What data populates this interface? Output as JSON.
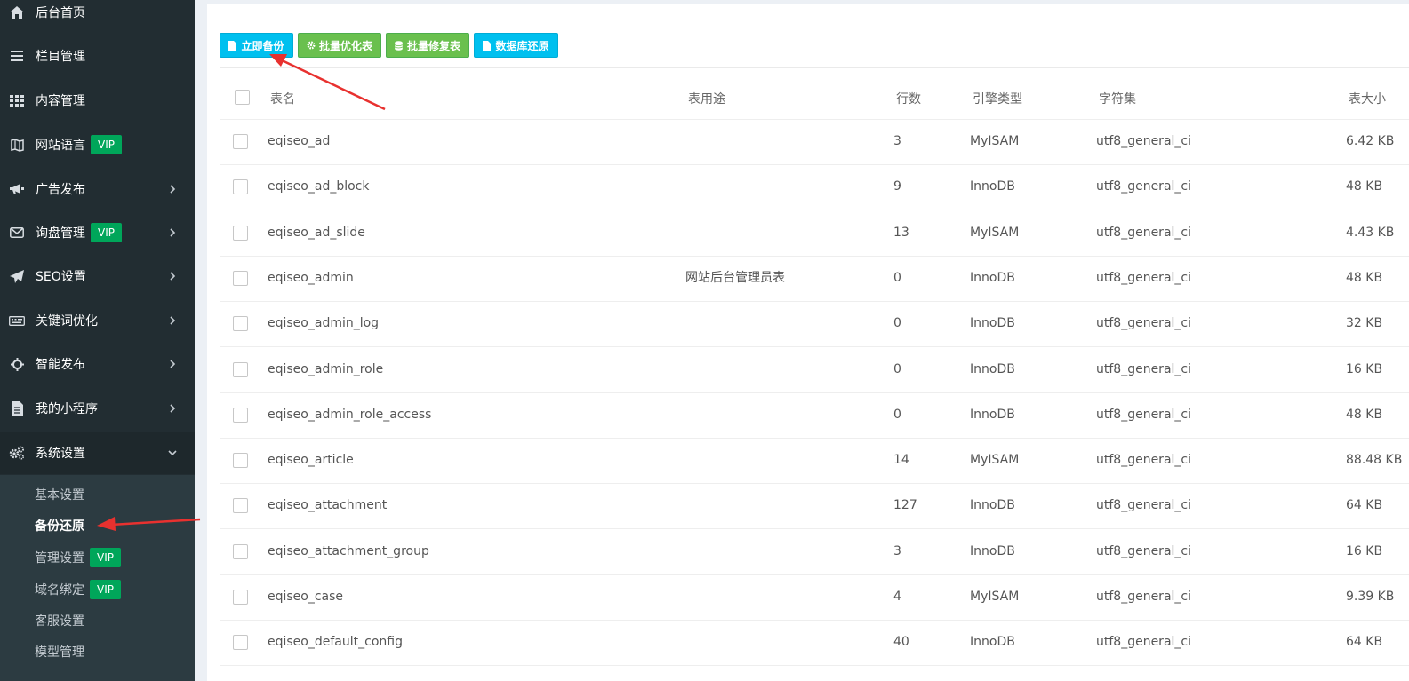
{
  "sidebar": {
    "menu": [
      {
        "label": "后台首页",
        "icon": "home-icon",
        "vip": false,
        "chevron": "none"
      },
      {
        "label": "栏目管理",
        "icon": "bars-icon",
        "vip": false,
        "chevron": "none"
      },
      {
        "label": "内容管理",
        "icon": "grid-icon",
        "vip": false,
        "chevron": "none"
      },
      {
        "label": "网站语言",
        "icon": "map-icon",
        "vip": true,
        "chevron": "none"
      },
      {
        "label": "广告发布",
        "icon": "bullhorn-icon",
        "vip": false,
        "chevron": "right"
      },
      {
        "label": "询盘管理",
        "icon": "envelope-icon",
        "vip": true,
        "chevron": "right"
      },
      {
        "label": "SEO设置",
        "icon": "paper-plane-icon",
        "vip": false,
        "chevron": "right"
      },
      {
        "label": "关键词优化",
        "icon": "keyboard-icon",
        "vip": false,
        "chevron": "right"
      },
      {
        "label": "智能发布",
        "icon": "crosshairs-icon",
        "vip": false,
        "chevron": "right"
      },
      {
        "label": "我的小程序",
        "icon": "file-text-icon",
        "vip": false,
        "chevron": "right"
      },
      {
        "label": "系统设置",
        "icon": "cogs-icon",
        "vip": false,
        "chevron": "down"
      }
    ],
    "vip_label": "VIP",
    "submenu": [
      {
        "label": "基本设置",
        "vip": false,
        "current": false
      },
      {
        "label": "备份还原",
        "vip": false,
        "current": true
      },
      {
        "label": "管理设置",
        "vip": true,
        "current": false
      },
      {
        "label": "域名绑定",
        "vip": true,
        "current": false
      },
      {
        "label": "客服设置",
        "vip": false,
        "current": false
      },
      {
        "label": "模型管理",
        "vip": false,
        "current": false
      }
    ]
  },
  "toolbar": {
    "buttons": [
      {
        "label": "立即备份",
        "icon": "file-icon",
        "color": "#00c0ef"
      },
      {
        "label": "批量优化表",
        "icon": "gear-icon",
        "color": "#6ac04e"
      },
      {
        "label": "批量修复表",
        "icon": "database-icon",
        "color": "#6ac04e"
      },
      {
        "label": "数据库还原",
        "icon": "file-icon",
        "color": "#00c0ef"
      }
    ]
  },
  "table": {
    "headers": {
      "name": "表名",
      "usage": "表用途",
      "rows": "行数",
      "engine": "引擎类型",
      "charset": "字符集",
      "size": "表大小"
    },
    "rows": [
      {
        "name": "eqiseo_ad",
        "usage": "",
        "rows": "3",
        "engine": "MyISAM",
        "charset": "utf8_general_ci",
        "size": "6.42 KB"
      },
      {
        "name": "eqiseo_ad_block",
        "usage": "",
        "rows": "9",
        "engine": "InnoDB",
        "charset": "utf8_general_ci",
        "size": "48 KB"
      },
      {
        "name": "eqiseo_ad_slide",
        "usage": "",
        "rows": "13",
        "engine": "MyISAM",
        "charset": "utf8_general_ci",
        "size": "4.43 KB"
      },
      {
        "name": "eqiseo_admin",
        "usage": "网站后台管理员表",
        "rows": "0",
        "engine": "InnoDB",
        "charset": "utf8_general_ci",
        "size": "48 KB"
      },
      {
        "name": "eqiseo_admin_log",
        "usage": "",
        "rows": "0",
        "engine": "InnoDB",
        "charset": "utf8_general_ci",
        "size": "32 KB"
      },
      {
        "name": "eqiseo_admin_role",
        "usage": "",
        "rows": "0",
        "engine": "InnoDB",
        "charset": "utf8_general_ci",
        "size": "16 KB"
      },
      {
        "name": "eqiseo_admin_role_access",
        "usage": "",
        "rows": "0",
        "engine": "InnoDB",
        "charset": "utf8_general_ci",
        "size": "48 KB"
      },
      {
        "name": "eqiseo_article",
        "usage": "",
        "rows": "14",
        "engine": "MyISAM",
        "charset": "utf8_general_ci",
        "size": "88.48 KB"
      },
      {
        "name": "eqiseo_attachment",
        "usage": "",
        "rows": "127",
        "engine": "InnoDB",
        "charset": "utf8_general_ci",
        "size": "64 KB"
      },
      {
        "name": "eqiseo_attachment_group",
        "usage": "",
        "rows": "3",
        "engine": "InnoDB",
        "charset": "utf8_general_ci",
        "size": "16 KB"
      },
      {
        "name": "eqiseo_case",
        "usage": "",
        "rows": "4",
        "engine": "MyISAM",
        "charset": "utf8_general_ci",
        "size": "9.39 KB"
      },
      {
        "name": "eqiseo_default_config",
        "usage": "",
        "rows": "40",
        "engine": "InnoDB",
        "charset": "utf8_general_ci",
        "size": "64 KB"
      }
    ]
  },
  "colors": {
    "sidebar_bg": "#222d32",
    "submenu_bg": "#2c3b41",
    "vip": "#00a65a",
    "annotation_arrow": "#e8312f"
  }
}
